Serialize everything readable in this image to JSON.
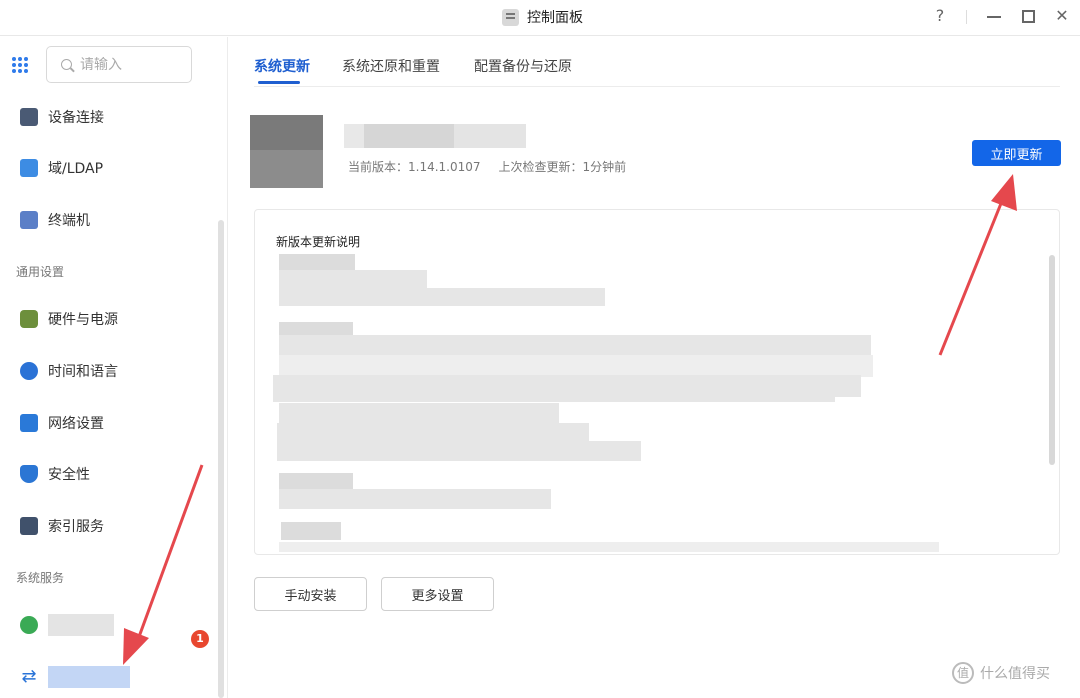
{
  "window": {
    "title": "控制面板",
    "help_label": "?",
    "close_label": "✕"
  },
  "sidebar": {
    "search_placeholder": "请输入",
    "items": [
      {
        "label": "设备连接",
        "icon": "device-connect-icon"
      },
      {
        "label": "域/LDAP",
        "icon": "ldap-icon"
      },
      {
        "label": "终端机",
        "icon": "terminal-icon"
      }
    ],
    "section_general": "通用设置",
    "general_items": [
      {
        "label": "硬件与电源",
        "icon": "hardware-power-icon"
      },
      {
        "label": "时间和语言",
        "icon": "time-language-icon"
      },
      {
        "label": "网络设置",
        "icon": "network-icon"
      },
      {
        "label": "安全性",
        "icon": "security-shield-icon"
      },
      {
        "label": "索引服务",
        "icon": "index-service-icon"
      }
    ],
    "section_system": "系统服务",
    "update_badge": "1"
  },
  "tabs": [
    {
      "label": "系统更新",
      "active": true
    },
    {
      "label": "系统还原和重置",
      "active": false
    },
    {
      "label": "配置备份与还原",
      "active": false
    }
  ],
  "update": {
    "current_version": "当前版本：1.14.1.0107",
    "last_check": "上次检查更新：1分钟前",
    "update_now_label": "立即更新"
  },
  "notes": {
    "title": "新版本更新说明"
  },
  "buttons": {
    "manual_install": "手动安装",
    "more_settings": "更多设置"
  },
  "watermark": {
    "text": "什么值得买",
    "icon_glyph": "值"
  },
  "colors": {
    "accent": "#1f5fd0",
    "primary_button": "#1366e8",
    "badge": "#e8472f",
    "annotation_arrow": "#e5484d"
  }
}
